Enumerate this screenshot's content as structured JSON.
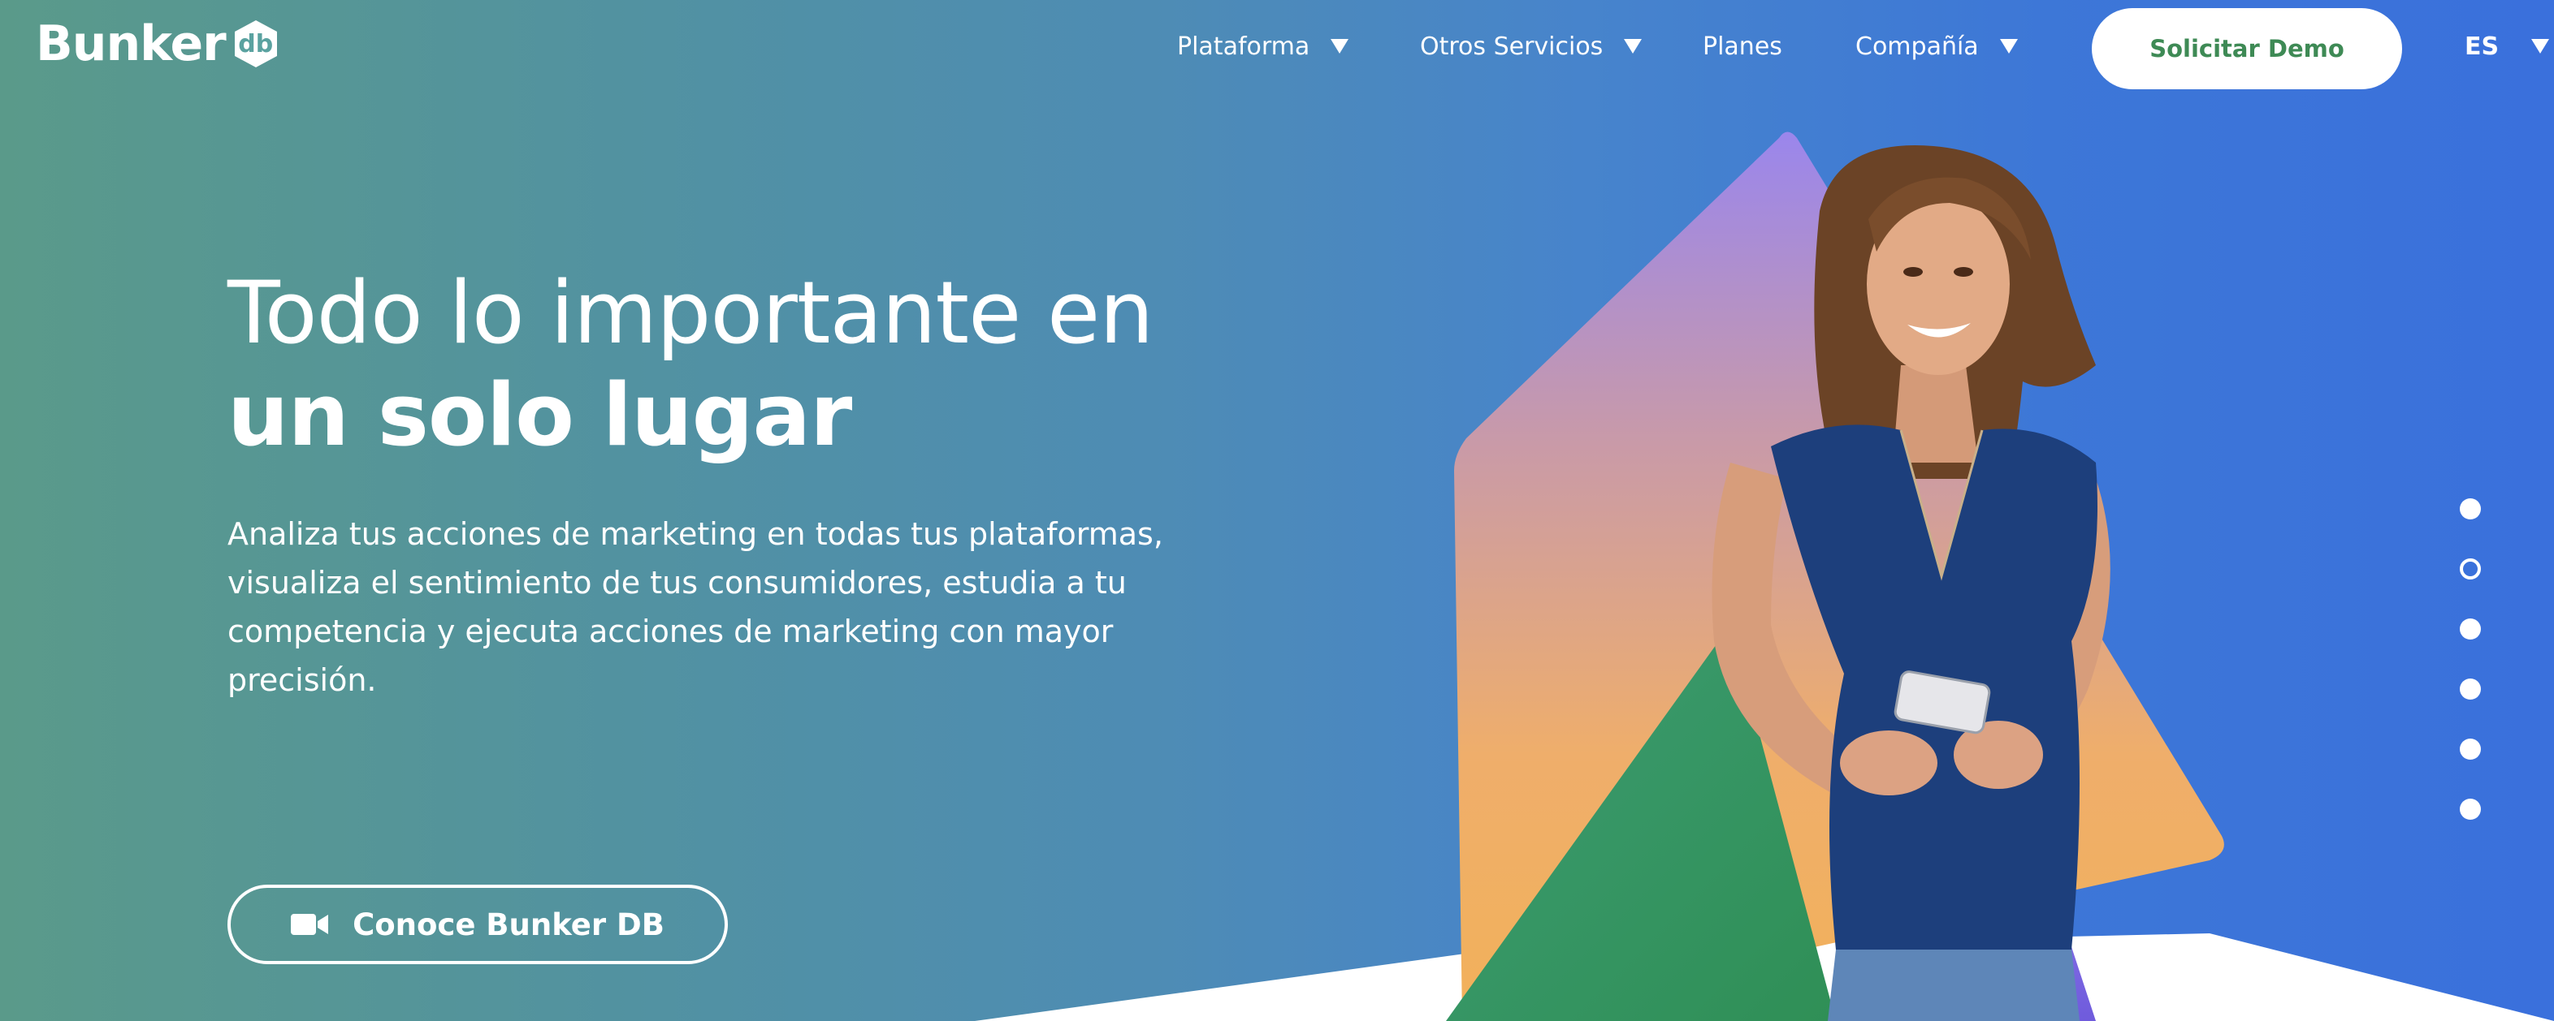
{
  "brand": {
    "name": "Bunker",
    "badge": "db"
  },
  "nav": {
    "items": [
      {
        "label": "Plataforma",
        "has_dropdown": true
      },
      {
        "label": "Otros Servicios",
        "has_dropdown": true
      },
      {
        "label": "Planes",
        "has_dropdown": false
      },
      {
        "label": "Compañía",
        "has_dropdown": true
      }
    ],
    "demo_button": "Solicitar Demo",
    "language": "ES"
  },
  "hero": {
    "title_line_1": "Todo lo importante en",
    "title_line_2": "un solo lugar",
    "description": "Analiza tus acciones de marketing en todas tus plataformas, visualiza el sentimiento de tus consumidores, estudia a tu competencia y ejecuta acciones de marketing con mayor precisión.",
    "cta_label": "Conoce Bunker DB",
    "cta_icon": "video-camera-icon"
  },
  "slider": {
    "total_dots": 6,
    "active_index": 1
  },
  "colors": {
    "demo_text": "#3e8a55",
    "background_left": "#5a9a8a",
    "background_right": "#3a70dc"
  }
}
